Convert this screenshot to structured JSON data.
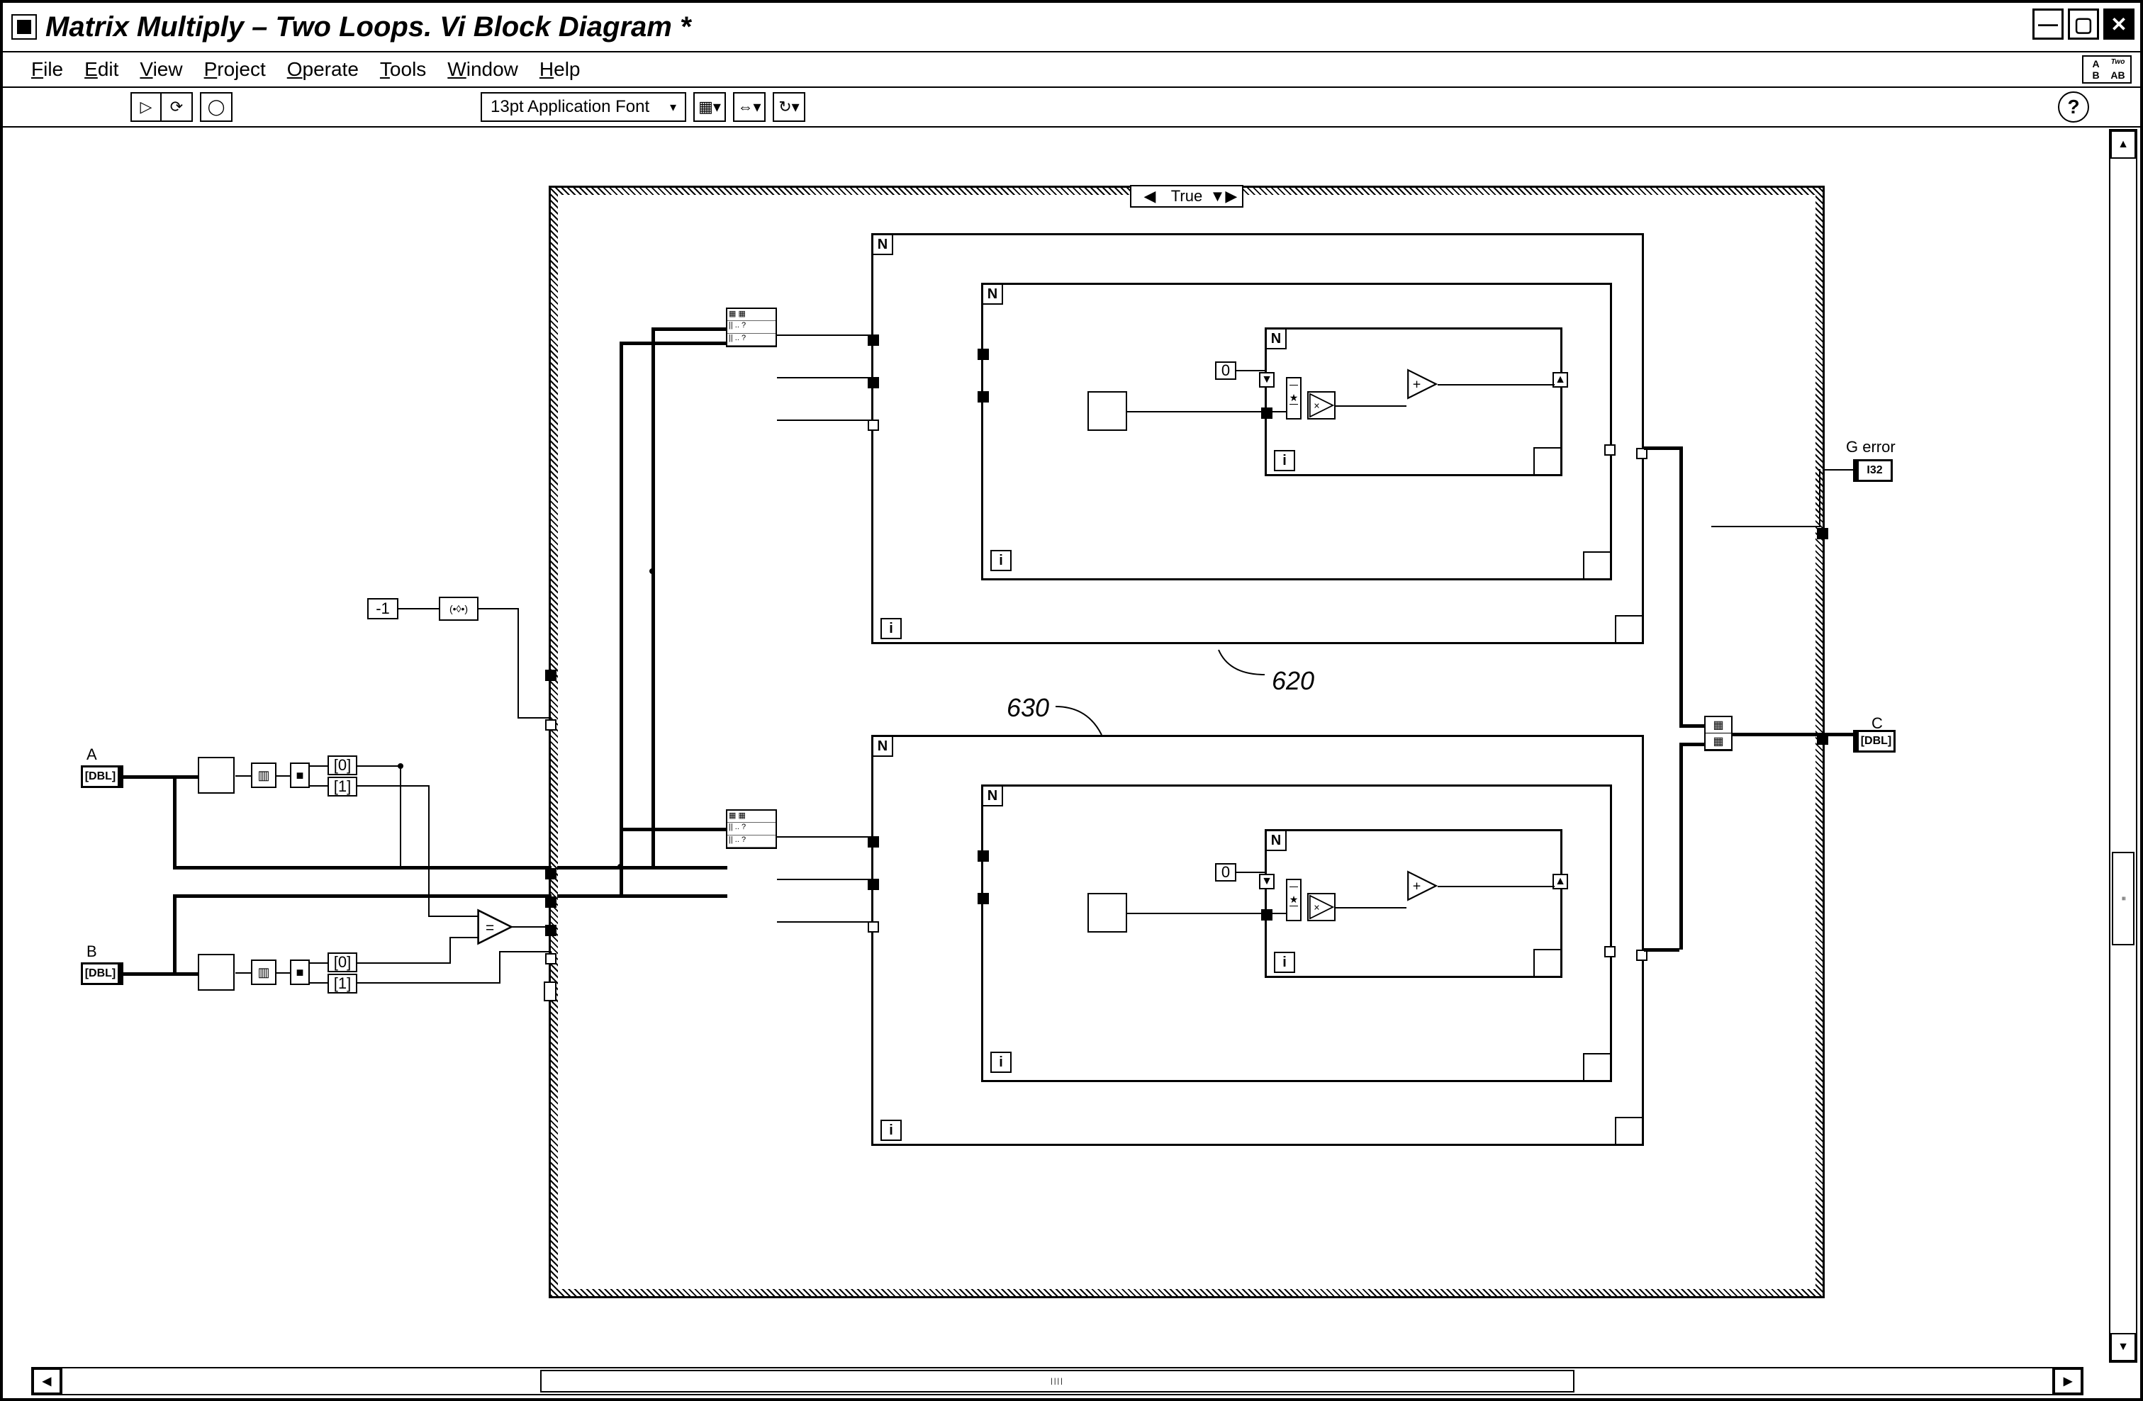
{
  "window": {
    "title": "Matrix Multiply – Two Loops. Vi Block Diagram *"
  },
  "menu": {
    "file": "File",
    "edit": "Edit",
    "view": "View",
    "project": "Project",
    "operate": "Operate",
    "tools": "Tools",
    "window": "Window",
    "help": "Help"
  },
  "toolbar": {
    "font": "13pt Application Font"
  },
  "iconpane": {
    "a": "A",
    "b": "B",
    "ab": "AB",
    "two": "Two"
  },
  "case": {
    "selector": "True"
  },
  "terminals": {
    "a_label": "A",
    "a_type": "[DBL]",
    "b_label": "B",
    "b_type": "[DBL]",
    "c_label": "C",
    "c_type": "[DBL]",
    "gerror_label": "G error",
    "gerror_type": "I32"
  },
  "constants": {
    "neg1": "-1",
    "zero_a": "0",
    "zero_b": "0",
    "idx0": "[0]",
    "idx1": "[1]"
  },
  "annotations": {
    "l620": "620",
    "l630": "630"
  }
}
